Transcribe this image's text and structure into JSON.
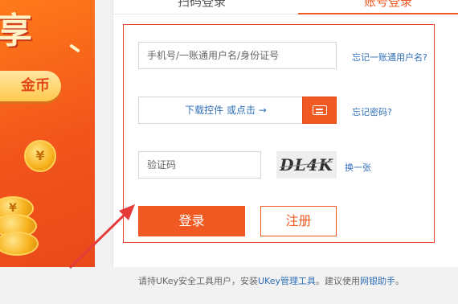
{
  "banner": {
    "big_text": "享",
    "pill_text": "金币",
    "coin_symbol": "¥"
  },
  "tabs": [
    {
      "label": "扫码登录"
    },
    {
      "label": "账号登录"
    }
  ],
  "form": {
    "username_placeholder": "手机号/一账通用户名/身份证号",
    "plugin_text": "下载控件 或点击 →",
    "captcha_placeholder": "验证码",
    "captcha_text": "DL4K",
    "forgot_username": "忘记一账通用户名?",
    "forgot_password": "忘记密码?",
    "refresh_captcha": "换一张",
    "login_label": "登录",
    "register_label": "注册"
  },
  "footer": {
    "note_prefix": "请持UKey安全工具用户，安装",
    "note_link1": "UKey管理工具",
    "note_middle": "。建议使用",
    "note_link2": "网银助手",
    "note_suffix": "。"
  },
  "colors": {
    "accent": "#f05a22",
    "form_border": "#e9412b",
    "link": "#2f6fb8",
    "annotation_arrow": "#e53b3b"
  }
}
